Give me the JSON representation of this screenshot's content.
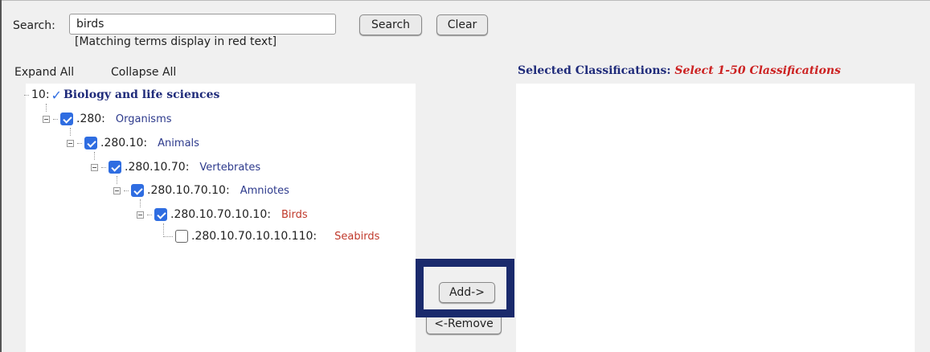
{
  "search": {
    "label": "Search:",
    "value": "birds",
    "hint": "[Matching terms display in red text]",
    "search_button": "Search",
    "clear_button": "Clear"
  },
  "tree_controls": {
    "expand_all": "Expand All",
    "collapse_all": "Collapse All"
  },
  "selected": {
    "title": "Selected Classifications:",
    "hint": "Select 1-50 Classifications"
  },
  "tree": {
    "root": {
      "code": "10:",
      "label": "Biology and life sciences"
    },
    "nodes": [
      {
        "code": ".280:",
        "label": "Organisms",
        "checked": true,
        "match": false
      },
      {
        "code": ".280.10:",
        "label": "Animals",
        "checked": true,
        "match": false
      },
      {
        "code": ".280.10.70:",
        "label": "Vertebrates",
        "checked": true,
        "match": false
      },
      {
        "code": ".280.10.70.10:",
        "label": "Amniotes",
        "checked": true,
        "match": false
      },
      {
        "code": ".280.10.70.10.10:",
        "label": "Birds",
        "checked": true,
        "match": true
      },
      {
        "code": ".280.10.70.10.10.110:",
        "label": "Seabirds",
        "checked": false,
        "match": true
      }
    ]
  },
  "actions": {
    "add": "Add->",
    "remove": "<-Remove"
  },
  "colors": {
    "checkbox_blue": "#2f6de1",
    "match_red": "#c0392b",
    "label_navy": "#2d3a8c",
    "highlight_navy": "#1a2a6c"
  }
}
